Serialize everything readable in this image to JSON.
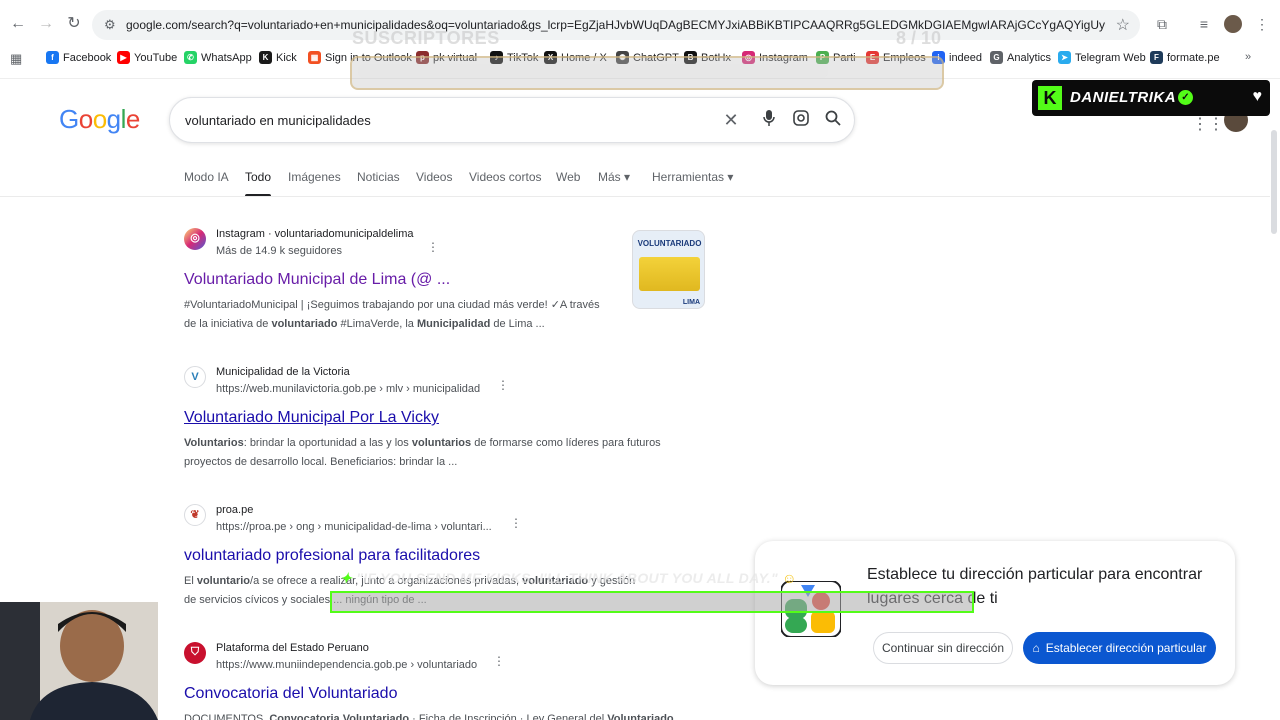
{
  "browser": {
    "url": "google.com/search?q=voluntariado+en+municipalidades&oq=voluntariado&gs_lcrp=EgZjaHJvbWUqDAgBECMYJxiABBiKBTIPCAAQRRg5GLEDGMkDGIAEMgwIARAjGCcYgAQYigUyBggCECMYJzIKC...",
    "bookmarks": [
      {
        "label": "Facebook",
        "icon": "facebook-icon",
        "color": "#1877f2",
        "glyph": "f"
      },
      {
        "label": "YouTube",
        "icon": "youtube-icon",
        "color": "#ff0000",
        "glyph": "▶"
      },
      {
        "label": "WhatsApp",
        "icon": "whatsapp-icon",
        "color": "#25d366",
        "glyph": "✆"
      },
      {
        "label": "Kick",
        "icon": "kick-icon",
        "color": "#1a1a1a",
        "glyph": "K"
      },
      {
        "label": "Sign in to Outlook",
        "icon": "microsoft-icon",
        "color": "#f25022",
        "glyph": "▦"
      },
      {
        "label": "pk virtual",
        "icon": "pk-icon",
        "color": "#8b2d2d",
        "glyph": "p"
      },
      {
        "label": "TikTok",
        "icon": "tiktok-icon",
        "color": "#111",
        "glyph": "♪"
      },
      {
        "label": "Home / X",
        "icon": "x-icon",
        "color": "#111",
        "glyph": "X"
      },
      {
        "label": "ChatGPT",
        "icon": "chatgpt-icon",
        "color": "#444",
        "glyph": "✺"
      },
      {
        "label": "BotHx",
        "icon": "bot-icon",
        "color": "#111",
        "glyph": "B"
      },
      {
        "label": "Instagram",
        "icon": "instagram-icon",
        "color": "#d62976",
        "glyph": "◎"
      },
      {
        "label": "Parti",
        "icon": "parti-icon",
        "color": "#4caf50",
        "glyph": "P"
      },
      {
        "label": "Empleos",
        "icon": "empleos-icon",
        "color": "#e53935",
        "glyph": "E"
      },
      {
        "label": "indeed",
        "icon": "indeed-icon",
        "color": "#2164f3",
        "glyph": "i"
      },
      {
        "label": "Analytics",
        "icon": "analytics-icon",
        "color": "#5f6368",
        "glyph": "G"
      },
      {
        "label": "Telegram Web",
        "icon": "telegram-icon",
        "color": "#2aabee",
        "glyph": "➤"
      },
      {
        "label": "formate.pe",
        "icon": "formate-icon",
        "color": "#1f3b5a",
        "glyph": "F"
      }
    ]
  },
  "overlay": {
    "subs_label": "SUSCRIPTORES",
    "subs_count": "8 / 10",
    "kick_name": "DANIELTRIKA",
    "alert_text": "\"IF YOU SEND ME KICKS, I'LL THINK ABOUT YOU ALL DAY.\""
  },
  "google": {
    "logo": [
      "G",
      "o",
      "o",
      "g",
      "l",
      "e"
    ],
    "query": "voluntariado en municipalidades",
    "tabs": [
      "Modo IA",
      "Todo",
      "Imágenes",
      "Noticias",
      "Videos",
      "Videos cortos",
      "Web",
      "Más ▾",
      "Herramientas ▾"
    ]
  },
  "results": [
    {
      "site": "Instagram · voluntariadomunicipaldelima",
      "cite": "Más de 14.9 k seguidores",
      "title": "Voluntariado Municipal de Lima (@ ...",
      "snippet1": "#VoluntariadoMunicipal | ¡Seguimos trabajando por una ciudad más verde! ✓A través",
      "snippet2": "de la iniciativa de voluntariado #LimaVerde, la Municipalidad de Lima ...",
      "thumb_title": "VOLUNTARIADO",
      "thumb_caption": "LIMA"
    },
    {
      "site": "Municipalidad de la Victoria",
      "cite": "https://web.munilavictoria.gob.pe › mlv › municipalidad",
      "title": "Voluntariado Municipal Por La Vicky",
      "snippet1": "Voluntarios: brindar la oportunidad a las y los voluntarios de formarse como líderes para futuros",
      "snippet2": "proyectos de desarrollo local. Beneficiarios: brindar la ..."
    },
    {
      "site": "proa.pe",
      "cite": "https://proa.pe › ong › municipalidad-de-lima › voluntari...",
      "title": "voluntariado profesional para facilitadores",
      "snippet1": "El voluntario/a se ofrece a realizar, junto a organizaciones privadas, voluntariado y gestión",
      "snippet2": "de servicios cívicos y sociales ... ningún tipo de ..."
    },
    {
      "site": "Plataforma del Estado Peruano",
      "cite": "https://www.muniindependencia.gob.pe › voluntariado",
      "title": "Convocatoria del Voluntariado",
      "snippet1": "DOCUMENTOS. Convocatoria Voluntariado · Ficha de Inscripción · Ley General del Voluntariado ..."
    }
  ],
  "popup": {
    "message": "Establece tu dirección particular para encontrar lugares cerca de ti",
    "continue_label": "Continuar sin dirección",
    "set_label": "Establecer dirección particular"
  }
}
